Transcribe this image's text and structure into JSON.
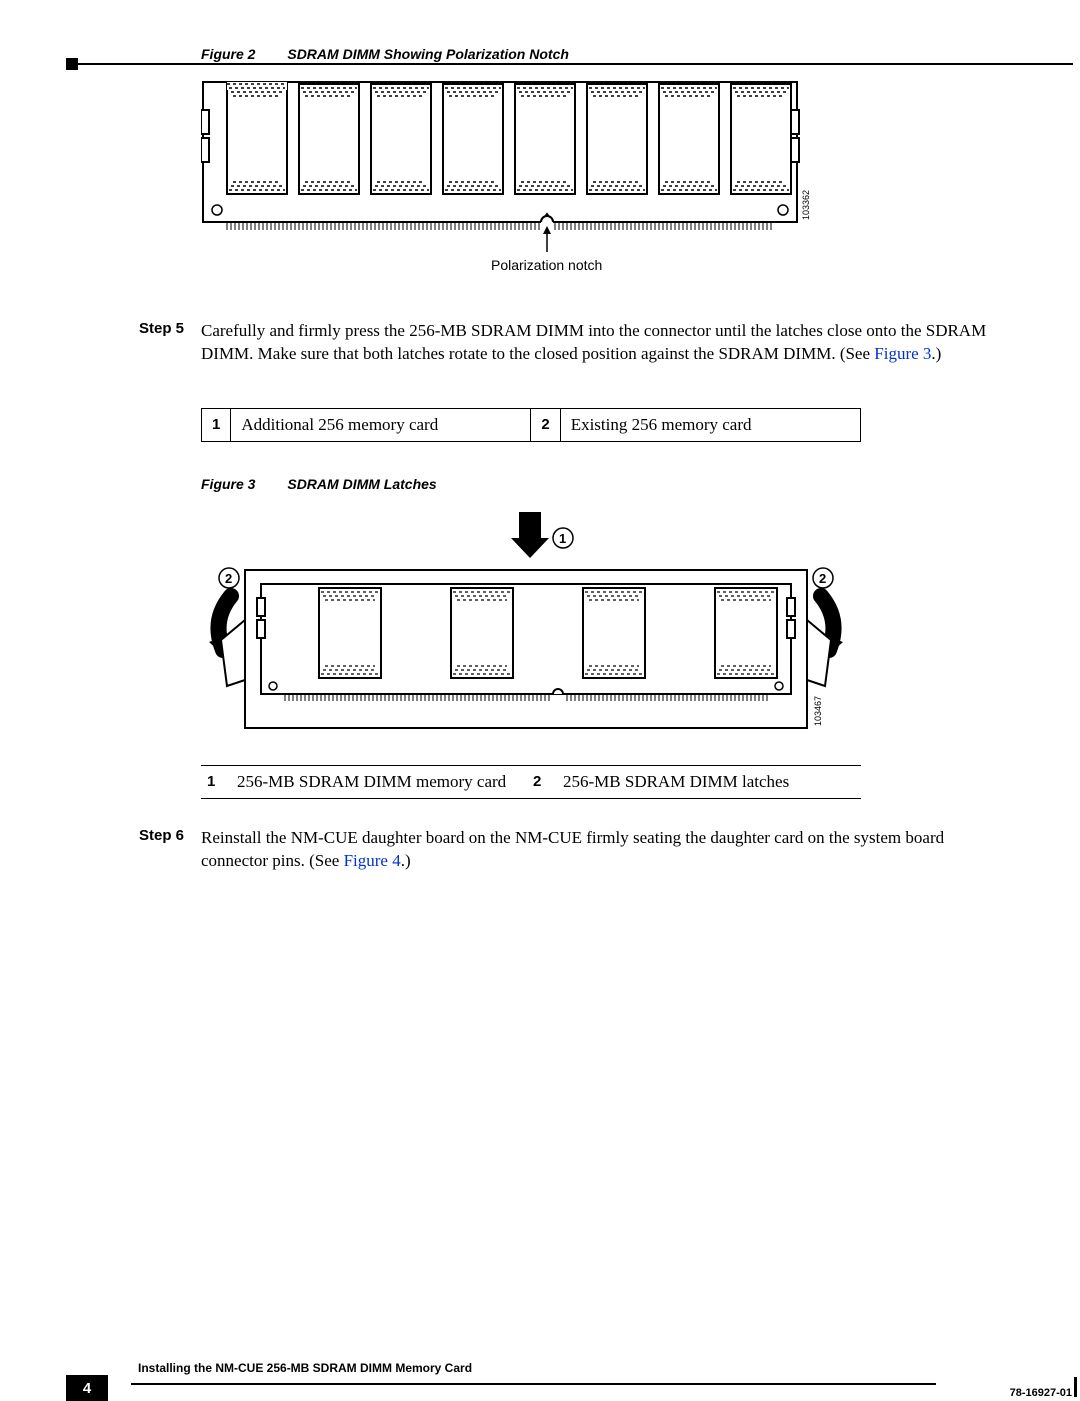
{
  "figure2": {
    "label": "Figure 2",
    "title": "SDRAM DIMM Showing Polarization Notch",
    "notch_label": "Polarization notch",
    "image_id": "103362"
  },
  "step5": {
    "label": "Step 5",
    "text_before": "Carefully and firmly press the 256-MB SDRAM DIMM into the connector until the latches close onto the SDRAM DIMM. Make sure that both latches rotate to the closed position against the SDRAM DIMM. (See ",
    "link": "Figure 3",
    "text_after": ".)"
  },
  "table1": {
    "r1n": "1",
    "r1t": "Additional 256 memory card",
    "r2n": "2",
    "r2t": "Existing 256 memory card"
  },
  "figure3": {
    "label": "Figure 3",
    "title": "SDRAM DIMM Latches",
    "image_id": "103467"
  },
  "table2": {
    "r1n": "1",
    "r1t": "256-MB SDRAM DIMM memory card",
    "r2n": "2",
    "r2t": "256-MB SDRAM DIMM latches"
  },
  "step6": {
    "label": "Step 6",
    "text_before": "Reinstall the NM-CUE daughter board on the NM-CUE firmly seating the daughter card on the system board connector pins. (See ",
    "link": "Figure 4",
    "text_after": ".)"
  },
  "footer": {
    "title": "Installing the NM-CUE 256-MB SDRAM DIMM Memory Card",
    "docnum": "78-16927-01",
    "page": "4"
  }
}
